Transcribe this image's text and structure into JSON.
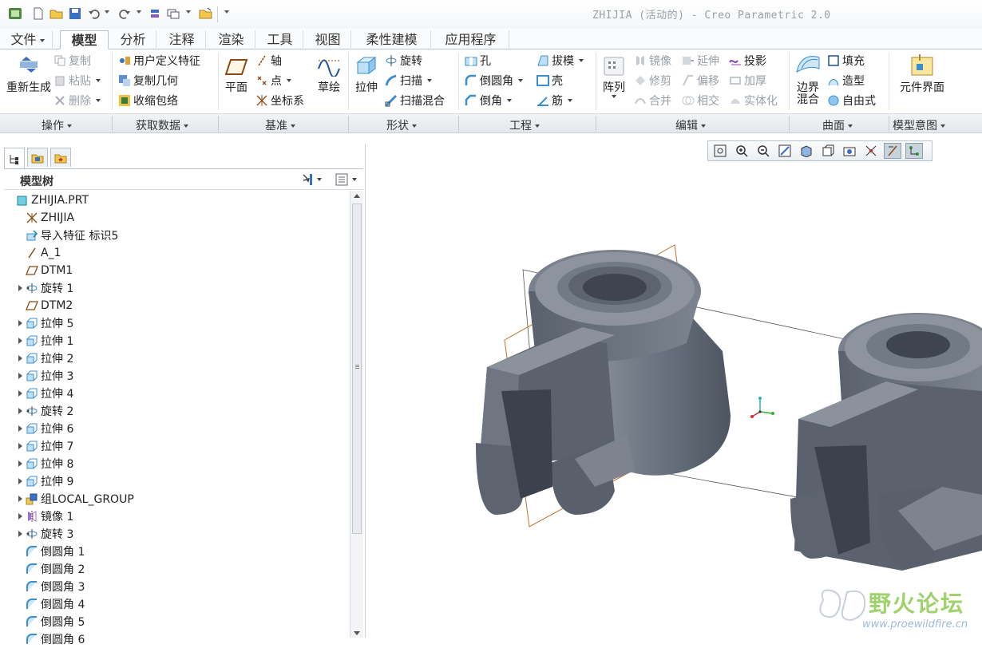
{
  "window": {
    "title": "ZHIJIA (活动的) - Creo Parametric 2.0"
  },
  "tabs": [
    {
      "label": "文件"
    },
    {
      "label": "模型"
    },
    {
      "label": "分析"
    },
    {
      "label": "注释"
    },
    {
      "label": "渲染"
    },
    {
      "label": "工具"
    },
    {
      "label": "视图"
    },
    {
      "label": "柔性建模"
    },
    {
      "label": "应用程序"
    }
  ],
  "ribbon": {
    "ops": {
      "regen": "重新生成",
      "copy": "复制",
      "paste": "粘贴",
      "delete": "删除"
    },
    "getdata": {
      "udf": "用户定义特征",
      "copygeom": "复制几何",
      "shrinkwrap": "收缩包络"
    },
    "datum": {
      "plane": "平面",
      "axis": "轴",
      "point": "点",
      "csys": "坐标系",
      "sketch": "草绘"
    },
    "shapes": {
      "extrude": "拉伸",
      "revolve": "旋转",
      "sweep": "扫描",
      "sweptblend": "扫描混合"
    },
    "engineering": {
      "hole": "孔",
      "round": "倒圆角",
      "chamfer": "倒角",
      "draft": "拔模",
      "shell": "壳",
      "rib": "筋"
    },
    "editing": {
      "pattern": "阵列",
      "mirror": "镜像",
      "trim": "修剪",
      "merge": "合并",
      "extend": "延伸",
      "offset": "偏移",
      "intersect": "相交",
      "project": "投影",
      "thicken": "加厚",
      "solidify": "实体化"
    },
    "surfaces": {
      "boundary": "边界混合",
      "fill": "填充",
      "style": "造型",
      "freestyle": "自由式"
    },
    "intent": {
      "component_interface": "元件界面"
    }
  },
  "groups": {
    "ops": "操作",
    "getdata": "获取数据",
    "datum": "基准",
    "shapes": "形状",
    "engineering": "工程",
    "editing": "编辑",
    "surfaces": "曲面",
    "intent": "模型意图"
  },
  "model_tree": {
    "title": "模型树",
    "items": [
      {
        "label": "ZHIJIA.PRT",
        "icon": "part-icon",
        "expandable": false
      },
      {
        "label": "ZHIJIA",
        "icon": "layer-icon",
        "expandable": false
      },
      {
        "label": "导入特征 标识5",
        "icon": "import-icon",
        "expandable": false
      },
      {
        "label": "A_1",
        "icon": "axis-icon",
        "expandable": false
      },
      {
        "label": "DTM1",
        "icon": "plane-icon",
        "expandable": false
      },
      {
        "label": "旋转 1",
        "icon": "revolve-icon",
        "expandable": true
      },
      {
        "label": "DTM2",
        "icon": "plane-icon",
        "expandable": false
      },
      {
        "label": "拉伸 5",
        "icon": "extrude-icon",
        "expandable": true
      },
      {
        "label": "拉伸 1",
        "icon": "extrude-icon",
        "expandable": true
      },
      {
        "label": "拉伸 2",
        "icon": "extrude-icon",
        "expandable": true
      },
      {
        "label": "拉伸 3",
        "icon": "extrude-icon",
        "expandable": true
      },
      {
        "label": "拉伸 4",
        "icon": "extrude-icon",
        "expandable": true
      },
      {
        "label": "旋转 2",
        "icon": "revolve-icon",
        "expandable": true
      },
      {
        "label": "拉伸 6",
        "icon": "extrude-icon",
        "expandable": true
      },
      {
        "label": "拉伸 7",
        "icon": "extrude-icon",
        "expandable": true
      },
      {
        "label": "拉伸 8",
        "icon": "extrude-icon",
        "expandable": true
      },
      {
        "label": "拉伸 9",
        "icon": "extrude-icon",
        "expandable": true
      },
      {
        "label": "组LOCAL_GROUP",
        "icon": "group-icon",
        "expandable": true
      },
      {
        "label": "镜像 1",
        "icon": "mirror-icon",
        "expandable": true
      },
      {
        "label": "旋转 3",
        "icon": "revolve-icon",
        "expandable": true
      },
      {
        "label": "倒圆角 1",
        "icon": "round-icon",
        "expandable": false
      },
      {
        "label": "倒圆角 2",
        "icon": "round-icon",
        "expandable": false
      },
      {
        "label": "倒圆角 3",
        "icon": "round-icon",
        "expandable": false
      },
      {
        "label": "倒圆角 4",
        "icon": "round-icon",
        "expandable": false
      },
      {
        "label": "倒圆角 5",
        "icon": "round-icon",
        "expandable": false
      },
      {
        "label": "倒圆角 6",
        "icon": "round-icon",
        "expandable": false
      }
    ]
  },
  "watermark": {
    "text": "野火论坛",
    "url": "www.proewildfire.cn"
  },
  "colors": {
    "model": "#6b7380",
    "datum_plane": "#c0702a",
    "accent": "#1e6fd0"
  }
}
